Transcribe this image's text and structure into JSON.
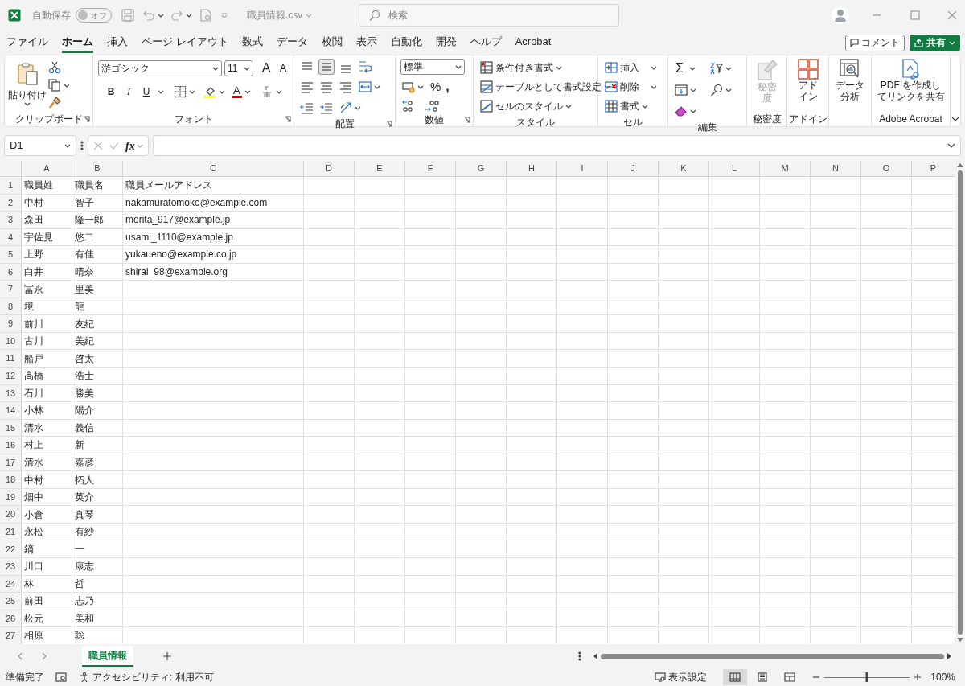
{
  "title_bar": {
    "autosave_label": "自動保存",
    "autosave_toggle": {
      "label": "オフ",
      "on": false
    },
    "filename": "職員情報.csv",
    "search_placeholder": "検索"
  },
  "ribbon_tabs": [
    {
      "label": "ファイル",
      "selected": false
    },
    {
      "label": "ホーム",
      "selected": true
    },
    {
      "label": "挿入",
      "selected": false
    },
    {
      "label": "ページ レイアウト",
      "selected": false
    },
    {
      "label": "数式",
      "selected": false
    },
    {
      "label": "データ",
      "selected": false
    },
    {
      "label": "校閲",
      "selected": false
    },
    {
      "label": "表示",
      "selected": false
    },
    {
      "label": "自動化",
      "selected": false
    },
    {
      "label": "開発",
      "selected": false
    },
    {
      "label": "ヘルプ",
      "selected": false
    },
    {
      "label": "Acrobat",
      "selected": false
    }
  ],
  "comment_button": "コメント",
  "share_button": "共有",
  "ribbon": {
    "clipboard": {
      "paste": "貼り付け",
      "label": "クリップボード"
    },
    "font": {
      "name": "游ゴシック",
      "size": "11",
      "grow": "A",
      "shrink": "A",
      "bold": "B",
      "italic": "I",
      "underline": "U",
      "font_color": "A",
      "label": "フォント"
    },
    "alignment": {
      "label": "配置"
    },
    "number": {
      "format": "標準",
      "percent": "%",
      "comma": ",",
      "label": "数値"
    },
    "styles": {
      "items": [
        "条件付き書式",
        "テーブルとして書式設定",
        "セルのスタイル"
      ],
      "label": "スタイル"
    },
    "cells": {
      "items": [
        "挿入",
        "削除",
        "書式"
      ],
      "label": "セル"
    },
    "editing": {
      "sum": "Σ",
      "label": "編集"
    },
    "sensitivity": {
      "lines": [
        "秘密",
        "度"
      ],
      "disabled": true,
      "label": "秘密度"
    },
    "addins": {
      "lines": [
        "アド",
        "イン"
      ],
      "label": "アドイン"
    },
    "analysis": {
      "lines": [
        "データ",
        "分析"
      ]
    },
    "acrobat": {
      "lines": [
        "PDF を作成し",
        "てリンクを共有"
      ],
      "label": "Adobe Acrobat"
    }
  },
  "formula_bar": {
    "name_box": "D1",
    "fx": "fx"
  },
  "columns": [
    "A",
    "B",
    "C",
    "D",
    "E",
    "F",
    "G",
    "H",
    "I",
    "J",
    "K",
    "L",
    "M",
    "N",
    "O",
    "P"
  ],
  "rows": [
    {
      "number": "1",
      "cells": [
        "職員姓",
        "職員名",
        "職員メールアドレス"
      ]
    },
    {
      "number": "2",
      "cells": [
        "中村",
        "智子",
        "nakamuratomoko@example.com"
      ]
    },
    {
      "number": "3",
      "cells": [
        "森田",
        "隆一郎",
        "morita_917@example.jp"
      ]
    },
    {
      "number": "4",
      "cells": [
        "宇佐見",
        "悠二",
        "usami_1110@example.jp"
      ]
    },
    {
      "number": "5",
      "cells": [
        "上野",
        "有佳",
        "yukaueno@example.co.jp"
      ]
    },
    {
      "number": "6",
      "cells": [
        "白井",
        "晴奈",
        "shirai_98@example.org"
      ]
    },
    {
      "number": "7",
      "cells": [
        "冨永",
        "里美"
      ]
    },
    {
      "number": "8",
      "cells": [
        "境",
        "龍"
      ]
    },
    {
      "number": "9",
      "cells": [
        "前川",
        "友紀"
      ]
    },
    {
      "number": "10",
      "cells": [
        "古川",
        "美紀"
      ]
    },
    {
      "number": "11",
      "cells": [
        "船戸",
        "啓太"
      ]
    },
    {
      "number": "12",
      "cells": [
        "高橋",
        "浩士"
      ]
    },
    {
      "number": "13",
      "cells": [
        "石川",
        "勝美"
      ]
    },
    {
      "number": "14",
      "cells": [
        "小林",
        "陽介"
      ]
    },
    {
      "number": "15",
      "cells": [
        "清水",
        "義信"
      ]
    },
    {
      "number": "16",
      "cells": [
        "村上",
        "新"
      ]
    },
    {
      "number": "17",
      "cells": [
        "清水",
        "嘉彦"
      ]
    },
    {
      "number": "18",
      "cells": [
        "中村",
        "拓人"
      ]
    },
    {
      "number": "19",
      "cells": [
        "畑中",
        "英介"
      ]
    },
    {
      "number": "20",
      "cells": [
        "小倉",
        "真琴"
      ]
    },
    {
      "number": "21",
      "cells": [
        "永松",
        "有紗"
      ]
    },
    {
      "number": "22",
      "cells": [
        "鏑",
        "一"
      ]
    },
    {
      "number": "23",
      "cells": [
        "川口",
        "康志"
      ]
    },
    {
      "number": "24",
      "cells": [
        "林",
        "哲"
      ]
    },
    {
      "number": "25",
      "cells": [
        "前田",
        "志乃"
      ]
    },
    {
      "number": "26",
      "cells": [
        "松元",
        "美和"
      ]
    },
    {
      "number": "27",
      "cells": [
        "相原",
        "聡"
      ]
    }
  ],
  "sheet_tabs": [
    {
      "label": "職員情報",
      "selected": true
    }
  ],
  "status_bar": {
    "ready": "準備完了",
    "accessibility": "アクセシビリティ: 利用不可",
    "display_settings": "表示設定",
    "views": [
      {
        "kind": "normal",
        "selected": true
      },
      {
        "kind": "page-layout",
        "selected": false
      },
      {
        "kind": "page-break",
        "selected": false
      }
    ],
    "zoom": {
      "level": 0.5,
      "reading": "100%"
    }
  }
}
